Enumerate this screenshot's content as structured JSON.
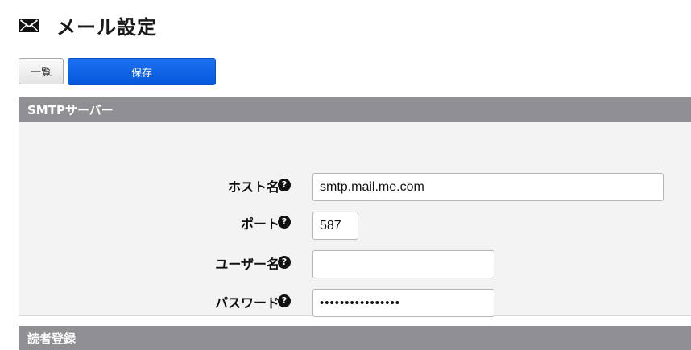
{
  "page": {
    "title": "メール設定",
    "icon": "mail-icon"
  },
  "toolbar": {
    "list_label": "一覧",
    "save_label": "保存"
  },
  "smtp_section": {
    "title": "SMTPサーバー",
    "fields": [
      {
        "label": "ホスト名",
        "value": "smtp.mail.me.com",
        "help_icon": "question-circle-icon"
      },
      {
        "label": "ポート",
        "value": "587",
        "help_icon": "question-circle-icon"
      },
      {
        "label": "ユーザー名",
        "value": "",
        "help_icon": "question-circle-icon"
      },
      {
        "label": "パスワード",
        "value": "••••••••••••••••",
        "help_icon": "question-circle-icon"
      }
    ]
  },
  "reader_section": {
    "title": "読者登録"
  },
  "colors": {
    "save_button": "#0658dc",
    "section_header": "#8f8f94",
    "section_body": "#f3f3f4"
  }
}
